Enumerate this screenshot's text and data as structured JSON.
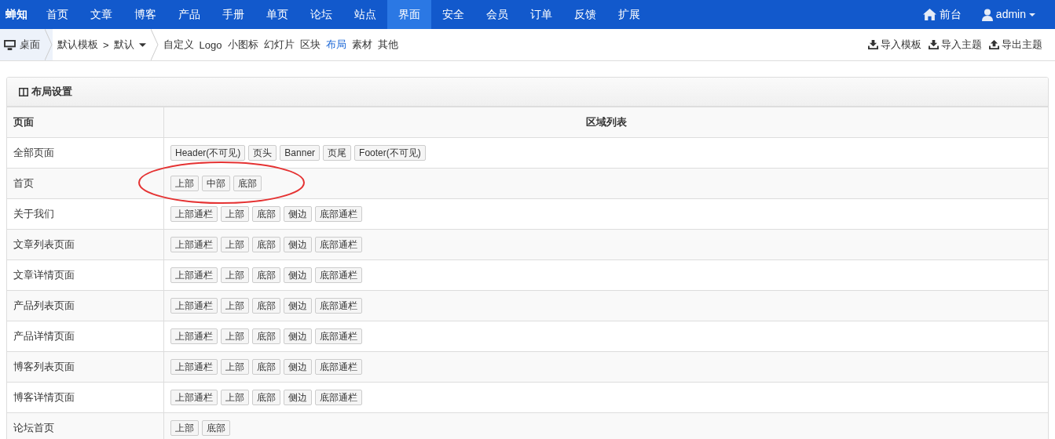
{
  "brand": "蝉知",
  "nav": [
    {
      "label": "首页",
      "selected": false
    },
    {
      "label": "文章",
      "selected": false
    },
    {
      "label": "博客",
      "selected": false
    },
    {
      "label": "产品",
      "selected": false
    },
    {
      "label": "手册",
      "selected": false
    },
    {
      "label": "单页",
      "selected": false
    },
    {
      "label": "论坛",
      "selected": false
    },
    {
      "label": "站点",
      "selected": false
    },
    {
      "label": "界面",
      "selected": true
    },
    {
      "label": "安全",
      "selected": false
    },
    {
      "label": "会员",
      "selected": false
    },
    {
      "label": "订单",
      "selected": false
    },
    {
      "label": "反馈",
      "selected": false
    },
    {
      "label": "扩展",
      "selected": false
    }
  ],
  "nav_right": {
    "frontend": "前台",
    "user": "admin"
  },
  "breadcrumb": {
    "home": "桌面",
    "template": "默认模板",
    "sep": ">",
    "theme": "默认"
  },
  "subnav": [
    {
      "label": "自定义",
      "selected": false
    },
    {
      "label": "Logo",
      "selected": false
    },
    {
      "label": "小图标",
      "selected": false
    },
    {
      "label": "幻灯片",
      "selected": false
    },
    {
      "label": "区块",
      "selected": false
    },
    {
      "label": "布局",
      "selected": true
    },
    {
      "label": "素材",
      "selected": false
    },
    {
      "label": "其他",
      "selected": false
    }
  ],
  "actions": [
    {
      "label": "导入模板",
      "kind": "download"
    },
    {
      "label": "导入主题",
      "kind": "download"
    },
    {
      "label": "导出主题",
      "kind": "upload"
    }
  ],
  "panel": {
    "title": "布局设置",
    "columns": [
      "页面",
      "区域列表"
    ],
    "rows": [
      {
        "page": "全部页面",
        "regions": [
          "Header(不可见)",
          "页头",
          "Banner",
          "页尾",
          "Footer(不可见)"
        ],
        "circled": false
      },
      {
        "page": "首页",
        "regions": [
          "上部",
          "中部",
          "底部"
        ],
        "circled": true
      },
      {
        "page": "关于我们",
        "regions": [
          "上部通栏",
          "上部",
          "底部",
          "侧边",
          "底部通栏"
        ],
        "circled": false
      },
      {
        "page": "文章列表页面",
        "regions": [
          "上部通栏",
          "上部",
          "底部",
          "侧边",
          "底部通栏"
        ],
        "circled": false
      },
      {
        "page": "文章详情页面",
        "regions": [
          "上部通栏",
          "上部",
          "底部",
          "侧边",
          "底部通栏"
        ],
        "circled": false
      },
      {
        "page": "产品列表页面",
        "regions": [
          "上部通栏",
          "上部",
          "底部",
          "侧边",
          "底部通栏"
        ],
        "circled": false
      },
      {
        "page": "产品详情页面",
        "regions": [
          "上部通栏",
          "上部",
          "底部",
          "侧边",
          "底部通栏"
        ],
        "circled": false
      },
      {
        "page": "博客列表页面",
        "regions": [
          "上部通栏",
          "上部",
          "底部",
          "侧边",
          "底部通栏"
        ],
        "circled": false
      },
      {
        "page": "博客详情页面",
        "regions": [
          "上部通栏",
          "上部",
          "底部",
          "侧边",
          "底部通栏"
        ],
        "circled": false
      },
      {
        "page": "论坛首页",
        "regions": [
          "上部",
          "底部"
        ],
        "circled": false
      }
    ]
  }
}
